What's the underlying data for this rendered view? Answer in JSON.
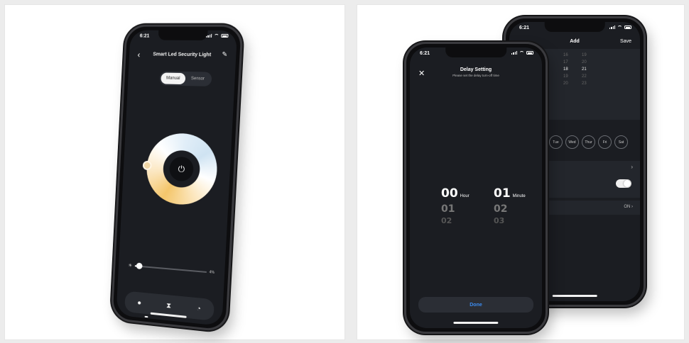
{
  "status": {
    "time": "6:21"
  },
  "light_screen": {
    "title": "Smart Led Security Light",
    "modes": [
      "Manual",
      "Sensor"
    ],
    "active_mode": "Manual",
    "brightness_pct": "4%",
    "brightness_value": 0.04
  },
  "add_screen": {
    "title": "Add",
    "save_label": "Save",
    "hours": [
      "16",
      "17",
      "18",
      "19",
      "20"
    ],
    "minutes": [
      "19",
      "20",
      "21",
      "22",
      "23"
    ],
    "selected_hour": "18",
    "selected_minute": "21",
    "days": [
      "Tue",
      "Wed",
      "Thur",
      "Fri",
      "Sat"
    ],
    "on_label": "ON"
  },
  "delay_screen": {
    "title": "Delay Setting",
    "subtitle": "Please set the delay turn-off time",
    "hour_values": [
      "00",
      "01",
      "02"
    ],
    "minute_values": [
      "01",
      "02",
      "03"
    ],
    "hour_unit": "Hour",
    "minute_unit": "Minute",
    "done_label": "Done"
  }
}
